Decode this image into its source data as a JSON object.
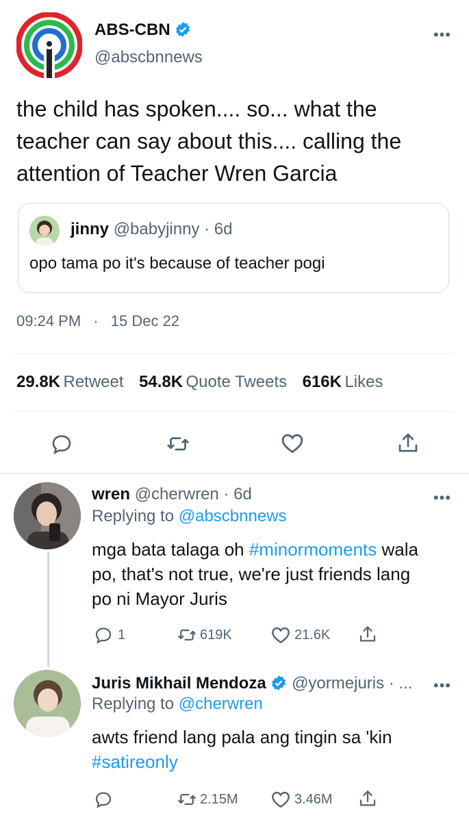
{
  "main_tweet": {
    "display_name": "ABS-CBN",
    "handle": "@abscbnnews",
    "text": "the child has spoken.... so... what the teacher can say about this.... calling the attention of Teacher Wren Garcia",
    "text_lines": [
      "the child has spoken.... so... what the",
      "teacher can say about this.... calling the",
      "attention of Teacher Wren Garcia"
    ],
    "time": "09:24 PM",
    "separator": "·",
    "date": "15 Dec 22",
    "more_icon": "more-dots-icon"
  },
  "quoted": {
    "name": "jinny",
    "handle": "@babyjinny",
    "age": "· 6d",
    "text": "opo tama po it's because of teacher pogi"
  },
  "stats": {
    "retweets_count": "29.8K",
    "retweets_label": "Retweet",
    "quotes_count": "54.8K",
    "quotes_label": "Quote Tweets",
    "likes_count": "616K",
    "likes_label": "Likes"
  },
  "replies": [
    {
      "name": "wren",
      "handle": "@cherwren",
      "age": "· 6d",
      "replying_prefix": "Replying to",
      "replying_to": "@abscbnnews",
      "text_line1_a": "mga bata talaga oh ",
      "text_line1_hashtag": "#minormoments",
      "text_line1_b": " wala",
      "text_line2": "po, that's not true, we're just friends lang",
      "text_line3": "po ni Mayor Juris",
      "reply_count": "1",
      "retweet_count": "619K",
      "like_count": "21.6K"
    },
    {
      "name": "Juris Mikhail Mendoza",
      "handle": "@yormejuris · ...",
      "replying_prefix": "Replying to",
      "replying_to": "@cherwren",
      "text_line1": "awts friend lang pala ang tingin sa 'kin",
      "text_hashtag": "#satireonly",
      "reply_count": "",
      "retweet_count": "2.15M",
      "like_count": "3.46M"
    }
  ],
  "colors": {
    "accent": "#1d9bf0",
    "text": "#0f1419",
    "secondary": "#536471",
    "border": "#e6ecf0"
  }
}
